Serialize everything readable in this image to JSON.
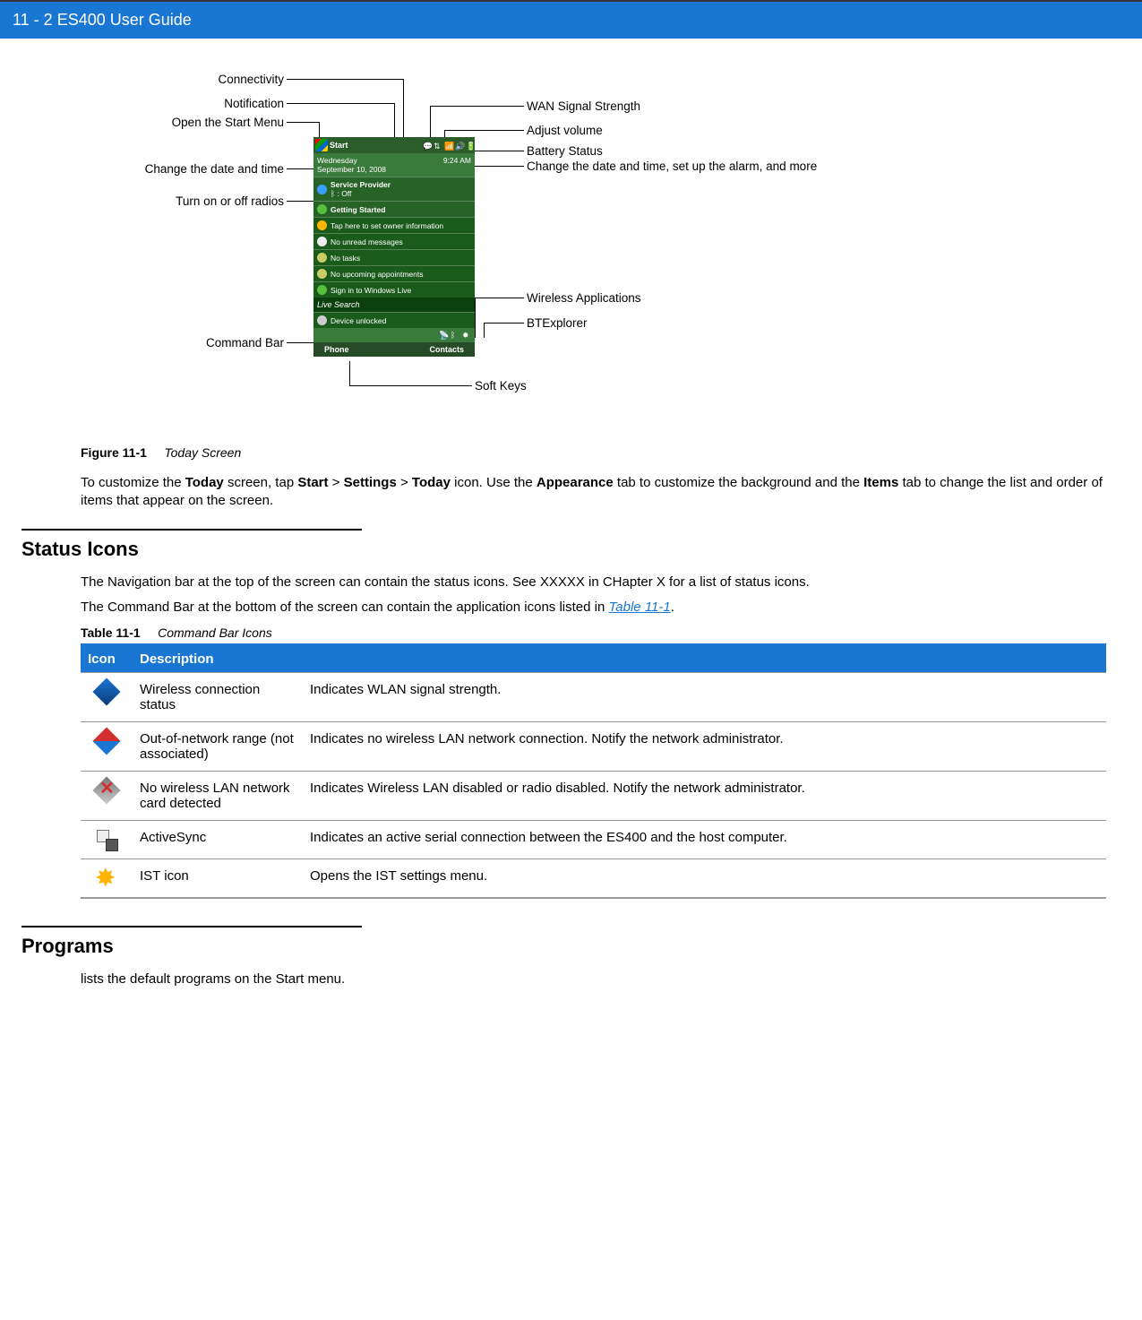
{
  "header": "11 - 2    ES400 User Guide",
  "callouts": {
    "connectivity": "Connectivity",
    "notification": "Notification",
    "open_start": "Open the Start Menu",
    "change_date_left": "Change the date and time",
    "turn_radios": "Turn on or off radios",
    "command_bar": "Command Bar",
    "wan": "WAN Signal Strength",
    "adjust_volume": "Adjust volume",
    "battery": "Battery Status",
    "change_date_right": "Change the date and time, set up the alarm, and more",
    "wireless_apps": "Wireless Applications",
    "btexplorer": "BTExplorer",
    "soft_keys": "Soft Keys"
  },
  "phone": {
    "start": "Start",
    "day": "Wednesday",
    "date": "September 10, 2008",
    "time": "9:24 AM",
    "service_provider": "Service Provider",
    "bt_off": ": Off",
    "getting_started": "Getting Started",
    "owner": "Tap here to set owner information",
    "unread": "No unread messages",
    "tasks": "No tasks",
    "appts": "No upcoming appointments",
    "signin": "Sign in to Windows Live",
    "live_search": "Live Search",
    "unlocked": "Device unlocked",
    "soft_left": "Phone",
    "soft_right": "Contacts"
  },
  "fig": {
    "label": "Figure 11-1",
    "title": "Today Screen"
  },
  "p1": {
    "pre": "To customize the ",
    "b1": "Today",
    "mid1": " screen, tap ",
    "b2": "Start",
    "gt1": " > ",
    "b3": "Settings",
    "gt2": " > ",
    "b4": "Today",
    "mid2": " icon. Use the ",
    "b5": "Appearance",
    "mid3": " tab to customize the background and the ",
    "b6": "Items",
    "end": " tab to change the list and order of items that appear on the screen."
  },
  "sec1": {
    "title": "Status Icons",
    "p1": "The Navigation bar at the top of the screen can contain the status icons. See XXXXX in CHapter X for a list of status icons.",
    "p2_pre": "The Command Bar at the bottom of the screen can contain the application icons listed in ",
    "p2_link": "Table 11-1",
    "p2_post": "."
  },
  "table": {
    "caption_label": "Table 11-1",
    "caption_title": "Command Bar Icons",
    "h_icon": "Icon",
    "h_desc": "Description",
    "rows": [
      {
        "name": "Wireless connection status",
        "desc": "Indicates WLAN signal strength."
      },
      {
        "name": "Out-of-network range (not associated)",
        "desc": "Indicates no wireless LAN network connection. Notify the network administrator."
      },
      {
        "name": "No wireless LAN network card detected",
        "desc": "Indicates Wireless LAN disabled or radio disabled. Notify the network administrator."
      },
      {
        "name": "ActiveSync",
        "desc": "Indicates an active serial connection between the ES400 and the host computer."
      },
      {
        "name": "IST icon",
        "desc": "Opens the IST settings menu."
      }
    ]
  },
  "sec2": {
    "title": "Programs",
    "p_pre": "lists the default programs on the ",
    "p_b": "Start",
    "p_post": " menu."
  }
}
